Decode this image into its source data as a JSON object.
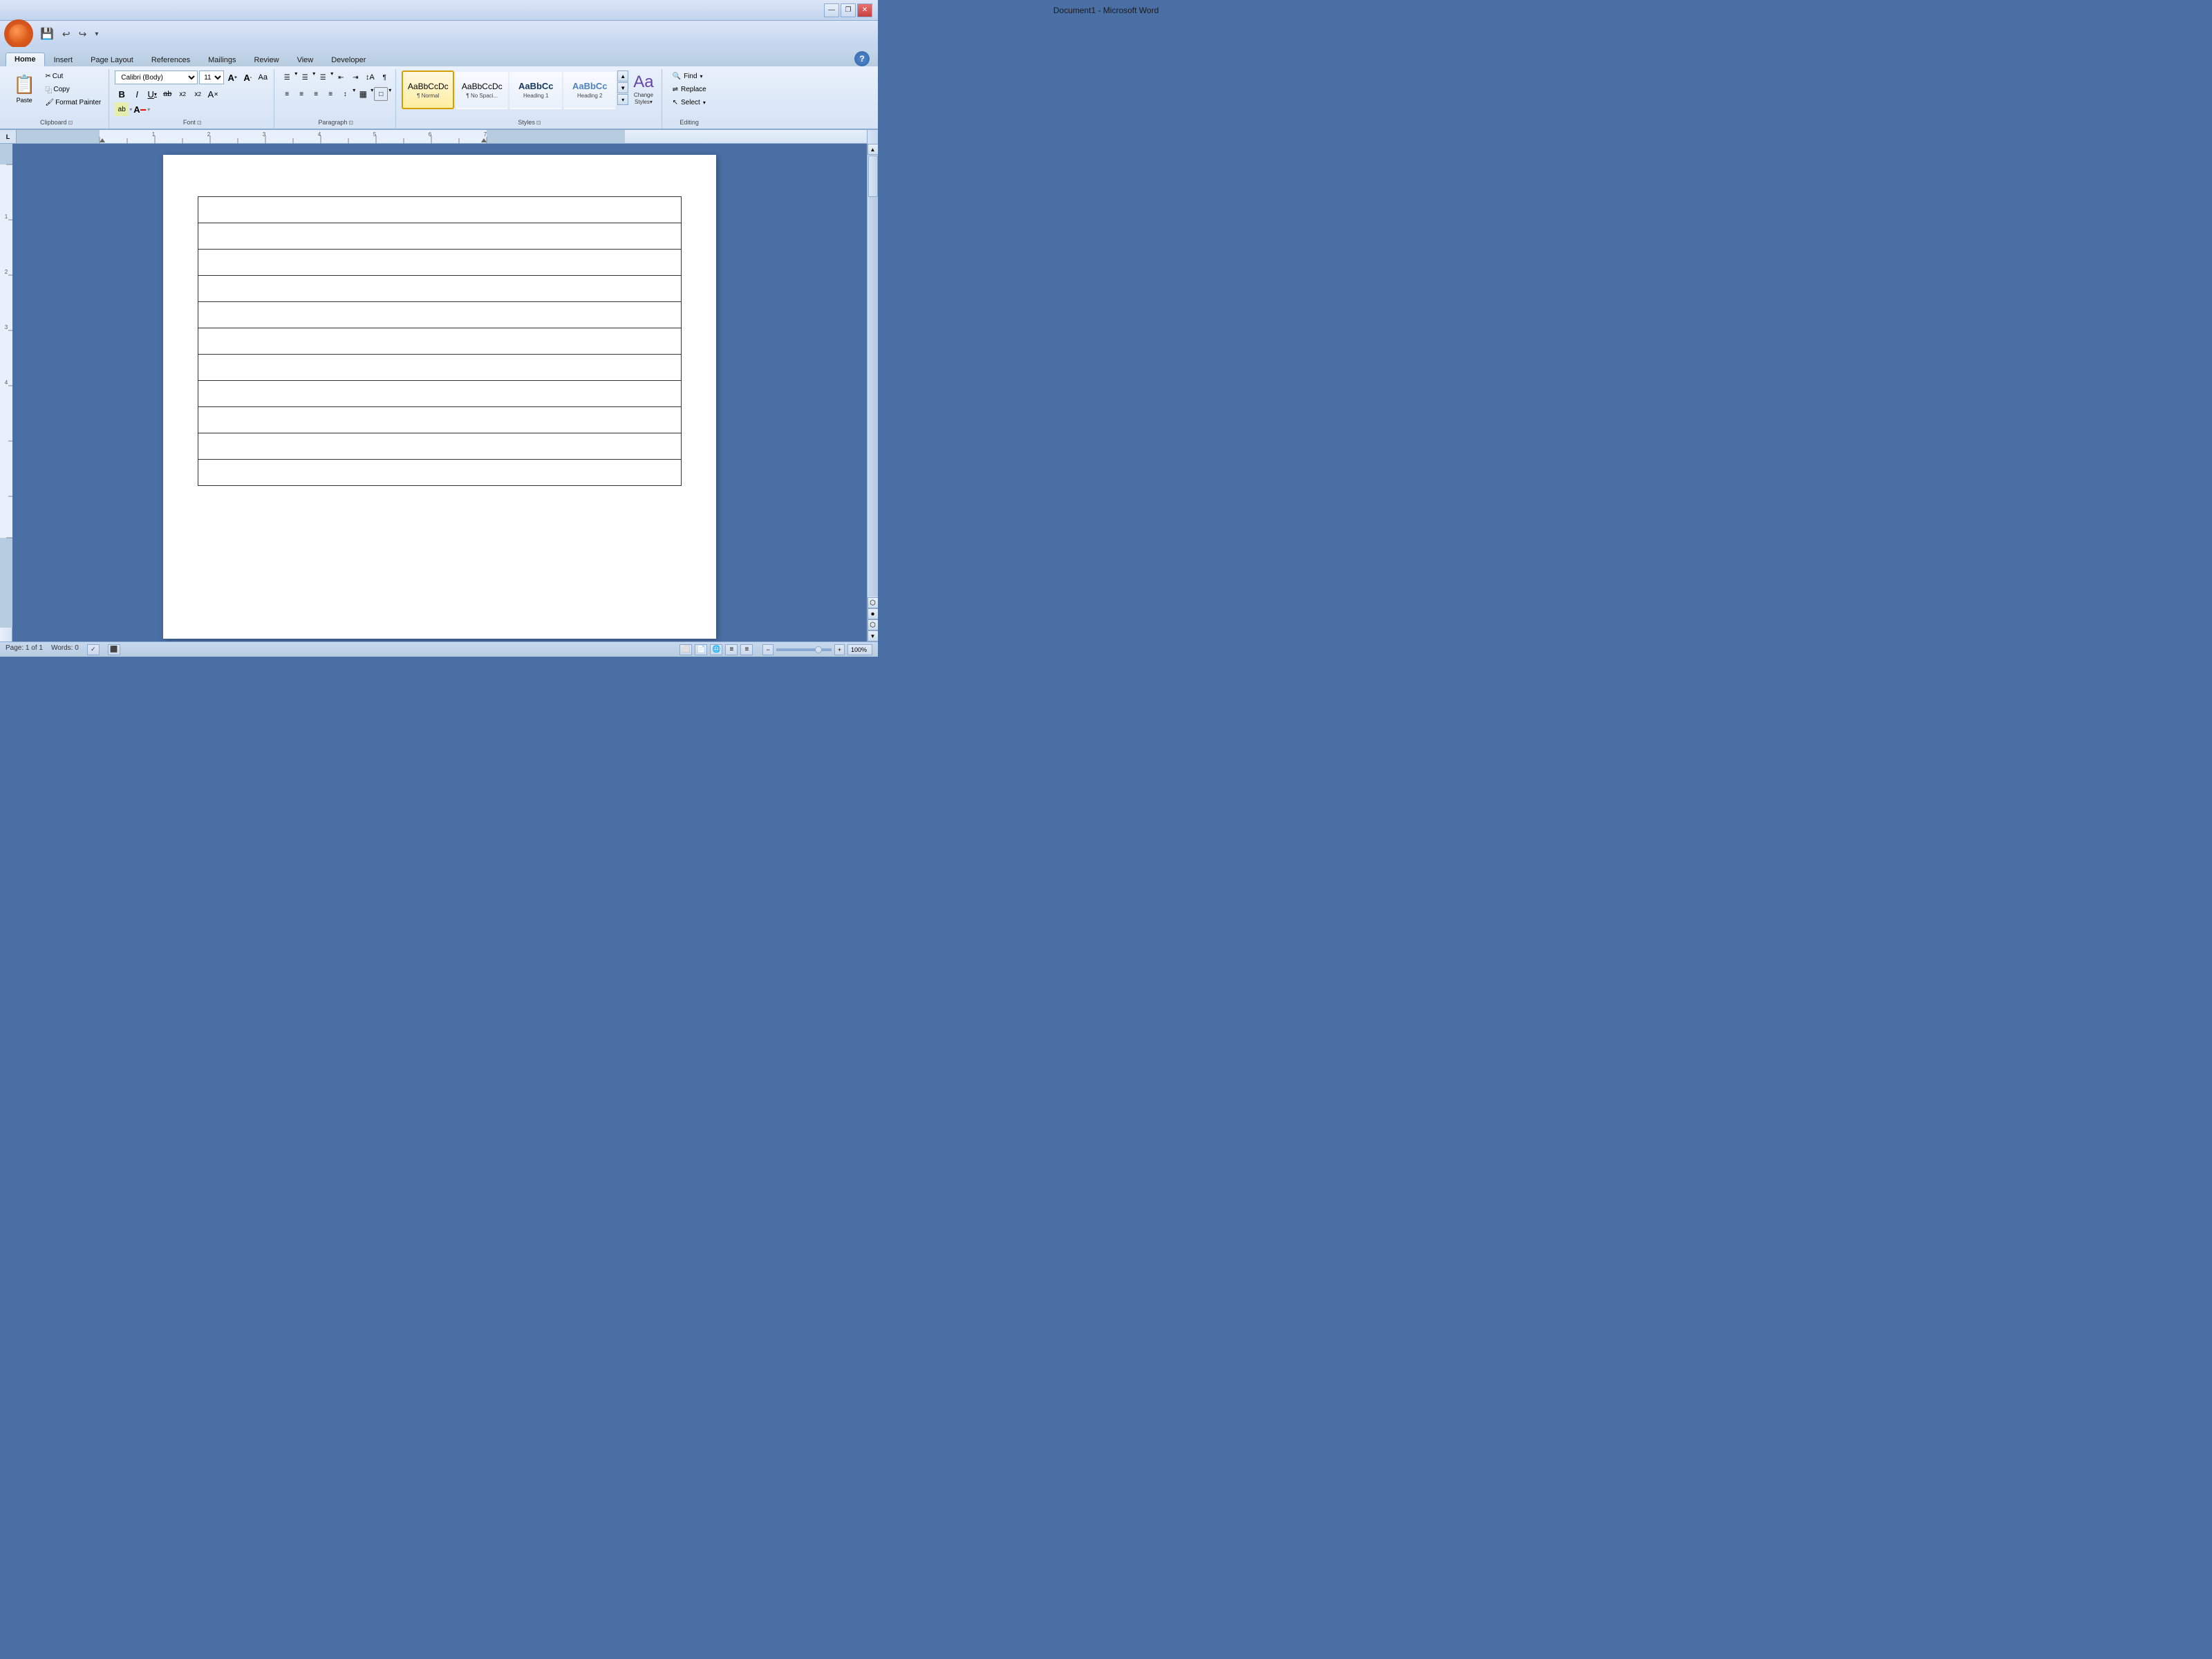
{
  "titlebar": {
    "title": "Document1 - Microsoft Word",
    "minimize": "—",
    "restore": "❐",
    "close": "✕"
  },
  "qat": {
    "save": "💾",
    "undo": "↩",
    "redo": "↪",
    "dropdown": "▾"
  },
  "tabs": [
    {
      "id": "home",
      "label": "Home",
      "active": true
    },
    {
      "id": "insert",
      "label": "Insert",
      "active": false
    },
    {
      "id": "pagelayout",
      "label": "Page Layout",
      "active": false
    },
    {
      "id": "references",
      "label": "References",
      "active": false
    },
    {
      "id": "mailings",
      "label": "Mailings",
      "active": false
    },
    {
      "id": "review",
      "label": "Review",
      "active": false
    },
    {
      "id": "view",
      "label": "View",
      "active": false
    },
    {
      "id": "developer",
      "label": "Developer",
      "active": false
    }
  ],
  "ribbon": {
    "groups": {
      "clipboard": {
        "label": "Clipboard",
        "paste_label": "Paste",
        "cut_label": "Cut",
        "copy_label": "Copy",
        "format_painter_label": "Format Painter"
      },
      "font": {
        "label": "Font",
        "font_name": "Calibri (Body)",
        "font_size": "11",
        "bold": "B",
        "italic": "I",
        "underline": "U",
        "strikethrough": "ab",
        "subscript": "x₂",
        "superscript": "x²",
        "clear_format": "A",
        "grow_font": "A↑",
        "shrink_font": "A↓",
        "change_case": "Aa",
        "highlight": "ab",
        "font_color": "A"
      },
      "paragraph": {
        "label": "Paragraph",
        "bullets": "☰",
        "numbering": "☰",
        "multilevel": "☰",
        "decrease_indent": "⇤",
        "increase_indent": "⇥",
        "sort": "↕",
        "show_hide": "¶",
        "align_left": "≡",
        "align_center": "≡",
        "align_right": "≡",
        "justify": "≡",
        "line_spacing": "↕",
        "shading": "▦",
        "borders": "□"
      },
      "styles": {
        "label": "Styles",
        "items": [
          {
            "label": "¶ Normal",
            "sample": "AaBbCcDc",
            "active": true
          },
          {
            "label": "¶ No Spaci...",
            "sample": "AaBbCcDc",
            "active": false
          },
          {
            "label": "Heading 1",
            "sample": "AaBbCc",
            "active": false
          },
          {
            "label": "Heading 2",
            "sample": "AaBbCc",
            "active": false
          }
        ],
        "change_styles_label": "Change\nStyles"
      },
      "editing": {
        "label": "Editing",
        "find_label": "Find",
        "replace_label": "Replace",
        "select_label": "Select"
      }
    }
  },
  "ruler": {
    "corner_label": "L",
    "marks": "· · · · 1 · · · · 2 · · · · 3 · · · · 4 · · · · 5 · · · · 6 · · · · 7 ·"
  },
  "document": {
    "page_info": "Page: 1 of 1",
    "words_info": "Words: 0",
    "table_rows": 11
  },
  "statusbar": {
    "page": "Page: 1 of 1",
    "words": "Words: 0",
    "zoom": "100%",
    "zoom_minus": "−",
    "zoom_plus": "+"
  }
}
